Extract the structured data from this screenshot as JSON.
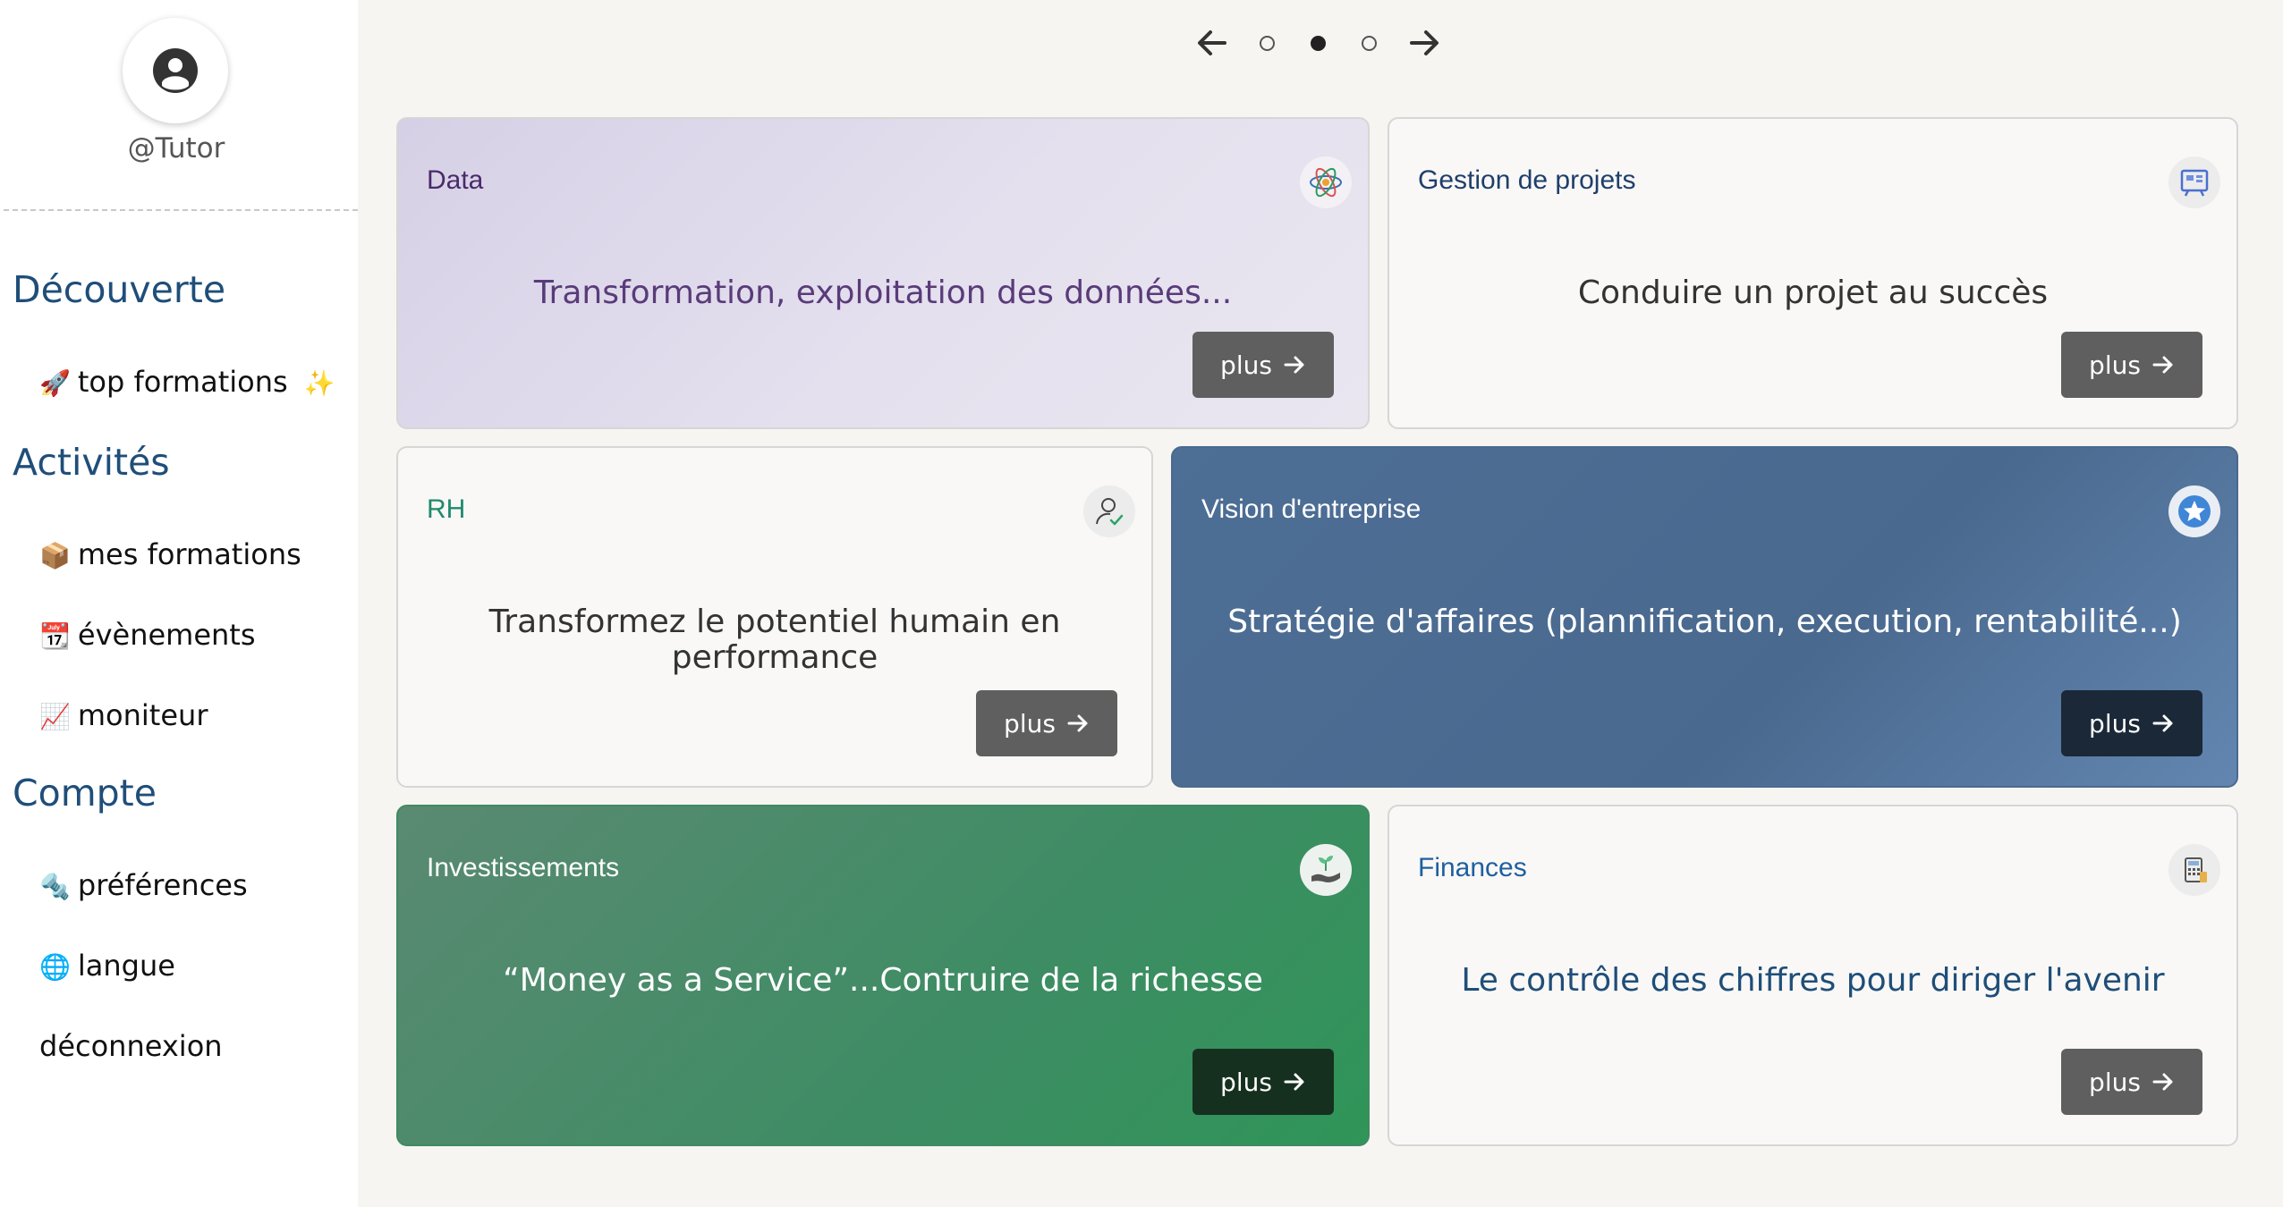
{
  "sidebar": {
    "username": "@Tutor",
    "sections": [
      {
        "title": "Découverte"
      },
      {
        "title": "Activités"
      },
      {
        "title": "Compte"
      }
    ],
    "items": {
      "top_formations": {
        "emoji_left": "🚀",
        "label": "top formations",
        "emoji_right": "✨"
      },
      "mes_formations": {
        "emoji": "📦",
        "label": "mes formations"
      },
      "evenements": {
        "emoji": "📆",
        "label": "évènements"
      },
      "moniteur": {
        "emoji": "📈",
        "label": "moniteur"
      },
      "preferences": {
        "emoji": "🔩",
        "label": "préférences"
      },
      "langue": {
        "emoji": "🌐",
        "label": "langue"
      },
      "deconnexion": {
        "label": "déconnexion"
      }
    }
  },
  "carousel": {
    "pages": 3,
    "active_index": 1,
    "prev_icon": "arrow-left-icon",
    "next_icon": "arrow-right-icon"
  },
  "cards": [
    {
      "title": "Data",
      "description": "Transformation, exploitation des données...",
      "button": "plus",
      "icon": "atom-icon",
      "colors": {
        "title": "#4a2a6a",
        "desc": "#5a3b7a",
        "bg": "#d9d3e8"
      }
    },
    {
      "title": "Gestion de projets",
      "description": "Conduire un projet au succès",
      "button": "plus",
      "icon": "project-board-icon",
      "colors": {
        "title": "#1f3f6b",
        "desc": "#333333"
      }
    },
    {
      "title": "RH",
      "description": "Transformez le potentiel humain en performance",
      "button": "plus",
      "icon": "person-check-icon",
      "colors": {
        "title": "#1f8a6e",
        "desc": "#333333"
      }
    },
    {
      "title": "Vision d'entreprise",
      "description": "Stratégie d'affaires (plannification, execution, rentabilité...)",
      "button": "plus",
      "icon": "star-badge-icon",
      "colors": {
        "title": "#ffffff",
        "desc": "#ffffff",
        "bg": "#4b6b92"
      }
    },
    {
      "title": "Investissements",
      "description": "“Money as a Service”...Contruire de la richesse",
      "button": "plus",
      "icon": "money-hand-icon",
      "colors": {
        "title": "#ffffff",
        "desc": "#ffffff",
        "bg": "#3e8c64"
      }
    },
    {
      "title": "Finances",
      "description": "Le contrôle des chiffres pour diriger l'avenir",
      "button": "plus",
      "icon": "calculator-icon",
      "colors": {
        "title": "#1f5fa0",
        "desc": "#1f4e79"
      }
    }
  ]
}
